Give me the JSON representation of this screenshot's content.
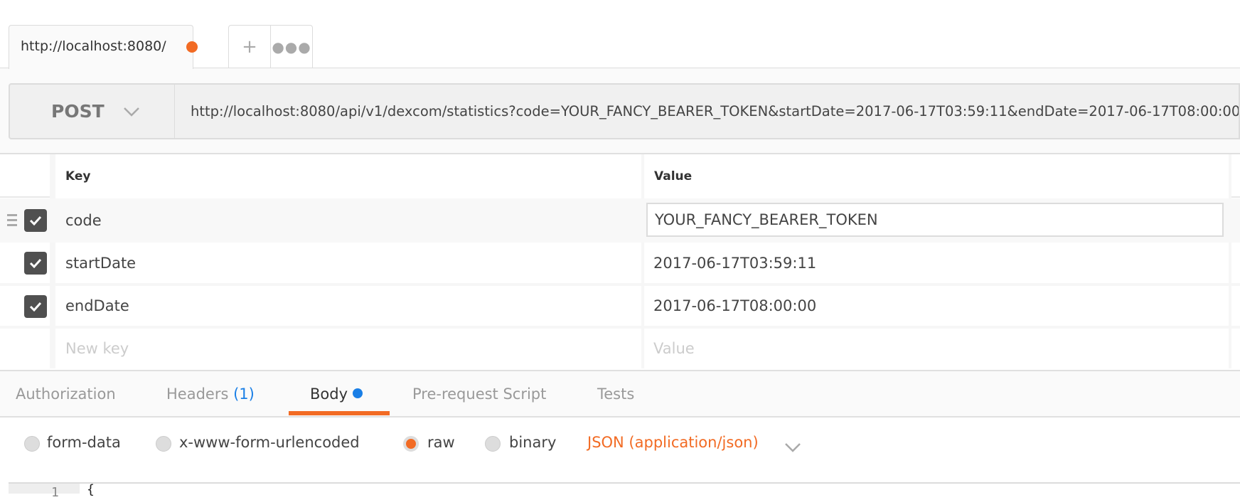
{
  "tabs": {
    "active_label": "http://localhost:8080/",
    "unsaved_color": "#f26b24",
    "new_tab_icon": "plus",
    "more_icon": "ellipsis"
  },
  "request": {
    "method": "POST",
    "url": "http://localhost:8080/api/v1/dexcom/statistics?code=YOUR_FANCY_BEARER_TOKEN&startDate=2017-06-17T03:59:11&endDate=2017-06-17T08:00:00"
  },
  "params": {
    "headers": {
      "key": "Key",
      "value": "Value"
    },
    "rows": [
      {
        "key": "code",
        "value": "YOUR_FANCY_BEARER_TOKEN",
        "checked": true
      },
      {
        "key": "startDate",
        "value": "2017-06-17T03:59:11",
        "checked": true
      },
      {
        "key": "endDate",
        "value": "2017-06-17T08:00:00",
        "checked": true
      }
    ],
    "new_key_placeholder": "New key",
    "new_value_placeholder": "Value"
  },
  "subtabs": [
    {
      "label": "Authorization"
    },
    {
      "label": "Headers",
      "count": "(1)"
    },
    {
      "label": "Body",
      "active": true
    },
    {
      "label": "Pre-request Script"
    },
    {
      "label": "Tests"
    }
  ],
  "body": {
    "modes": [
      "form-data",
      "x-www-form-urlencoded",
      "raw",
      "binary"
    ],
    "selected_mode": "raw",
    "content_type": "JSON (application/json)",
    "editor_line": "1",
    "editor_text": "{"
  },
  "colors": {
    "accent": "#f26b24",
    "blue": "#1a7fe6"
  }
}
